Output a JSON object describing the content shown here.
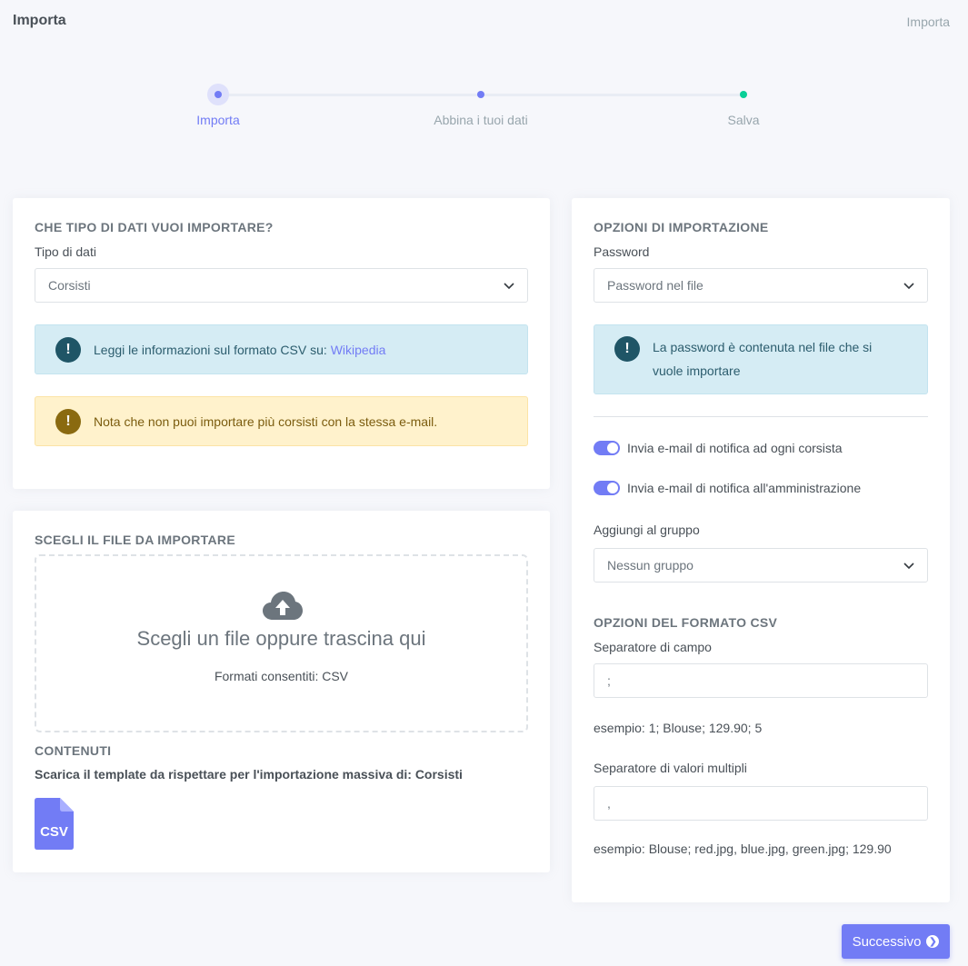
{
  "header": {
    "title": "Importa",
    "breadcrumb": "Importa"
  },
  "stepper": {
    "steps": [
      {
        "label": "Importa",
        "state": "active"
      },
      {
        "label": "Abbina i tuoi dati",
        "state": "pending"
      },
      {
        "label": "Salva",
        "state": "pending"
      }
    ]
  },
  "data_type_card": {
    "title": "CHE TIPO DI DATI VUOI IMPORTARE?",
    "type_label": "Tipo di dati",
    "type_value": "Corsisti",
    "info_text": "Leggi le informazioni sul formato CSV su: ",
    "info_link": "Wikipedia",
    "warning_text": "Nota che non puoi importare più corsisti con la stessa e-mail."
  },
  "file_card": {
    "title": "SCEGLI IL FILE DA IMPORTARE",
    "dropzone_title": "Scegli un file oppure trascina qui",
    "dropzone_formats": "Formati consentiti: CSV",
    "contents_title": "CONTENUTI",
    "template_text": "Scarica il template da rispettare per l'importazione massiva di: Corsisti",
    "csv_icon_text": "CSV"
  },
  "options_card": {
    "title": "OPZIONI DI IMPORTAZIONE",
    "password_label": "Password",
    "password_value": "Password nel file",
    "password_info": "La password è contenuta nel file che si vuole importare",
    "toggle_notify_students": "Invia e-mail di notifica ad ogni corsista",
    "toggle_notify_admin": "Invia e-mail di notifica all'amministrazione",
    "group_label": "Aggiungi al gruppo",
    "group_value": "Nessun gruppo",
    "csv_title": "OPZIONI DEL FORMATO CSV",
    "field_sep_label": "Separatore di campo",
    "field_sep_value": ";",
    "field_sep_example": "esempio: 1; Blouse; 129.90; 5",
    "multi_sep_label": "Separatore di valori multipli",
    "multi_sep_value": ",",
    "multi_sep_example": "esempio: Blouse; red.jpg, blue.jpg, green.jpg; 129.90"
  },
  "actions": {
    "next_label": "Successivo"
  },
  "colors": {
    "primary": "#727cf5",
    "success": "#0acf97",
    "info_bg": "#d5ecf4",
    "warning_bg": "#fff2cc"
  }
}
